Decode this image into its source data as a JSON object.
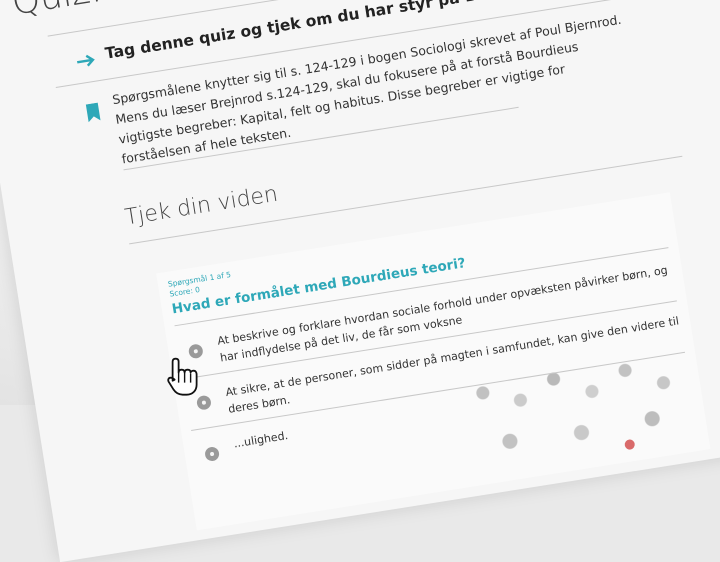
{
  "page": {
    "title": "Quiz: Har du styr på Bourdieu"
  },
  "intro": {
    "heading": "Tag denne quiz og tjek om du har styr på Bourdieu",
    "text": "Spørgsmålene knytter sig til s. 124-129 i bogen Sociologi skrevet af Poul Bjernrod. Mens du læser Brejnrod s.124-129, skal du fokusere på at forstå Bourdieus vigtigste begreber: Kapital, felt og habitus. Disse begreber er vigtige for forståelsen af hele teksten."
  },
  "section": {
    "title": "Tjek din viden"
  },
  "quiz": {
    "counter": "Spørgsmål 1 af 5",
    "score": "Score: 0",
    "question": "Hvad er formålet med Bourdieus teori?",
    "answers": [
      "At beskrive og forklare hvordan sociale forhold under opvæksten påvirker børn, og har indflydelse på det liv, de får som voksne",
      "At sikre, at de personer, som sidder på magten i samfundet, kan give den videre til deres børn.",
      "...ulighed."
    ]
  },
  "icons": {
    "intro_arrow": "arrow-right-icon",
    "intro_bookmark": "bookmark-icon",
    "pointer": "hand-pointer-icon"
  },
  "colors": {
    "accent": "#2ea8b8",
    "text": "#333333",
    "radio": "#9a9a9a"
  }
}
